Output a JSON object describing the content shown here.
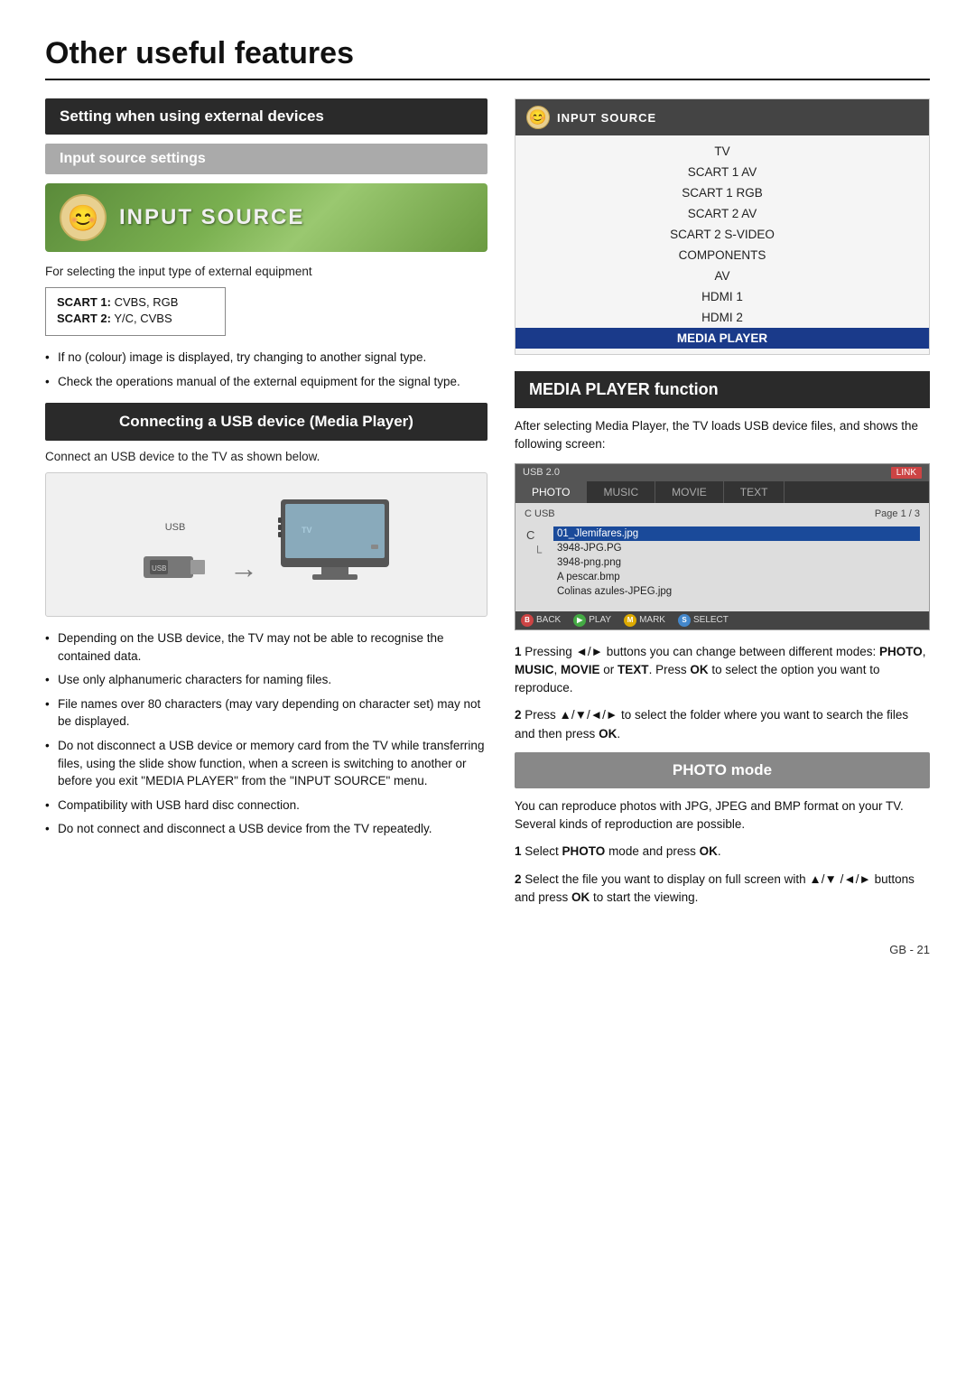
{
  "page": {
    "title": "Other useful features",
    "page_number": "GB - 21"
  },
  "left": {
    "section1": {
      "header": "Setting when using external devices",
      "subsection": "Input source settings",
      "banner_label": "INPUT SOURCE",
      "description": "For selecting the input type of external equipment",
      "scart_info": [
        "SCART 1: CVBS, RGB",
        "SCART 2: Y/C, CVBS"
      ],
      "bullets": [
        "If no (colour) image is displayed, try changing to another signal type.",
        "Check the operations manual of the external equipment for the signal type."
      ]
    },
    "section2": {
      "header": "Connecting a USB device (Media Player)",
      "description": "Connect an USB device to the TV as shown below.",
      "bullets": [
        "Depending on the USB device, the TV may not be able to recognise the contained data.",
        "Use only alphanumeric characters for naming files.",
        "File names over 80 characters (may vary depending on character set) may not be displayed.",
        "Do not disconnect a USB device or memory card from the TV while transferring files, using the slide show function, when a screen is switching to another or before you exit \"MEDIA PLAYER\" from the \"INPUT SOURCE\" menu.",
        "Compatibility with USB hard disc connection.",
        "Do not connect and disconnect a USB device from the TV repeatedly."
      ]
    }
  },
  "right": {
    "input_source_menu": {
      "header": "INPUT SOURCE",
      "items": [
        {
          "label": "TV",
          "active": false
        },
        {
          "label": "SCART 1 AV",
          "active": false
        },
        {
          "label": "SCART 1 RGB",
          "active": false
        },
        {
          "label": "SCART 2 AV",
          "active": false
        },
        {
          "label": "SCART 2 S-VIDEO",
          "active": false
        },
        {
          "label": "COMPONENTS",
          "active": false
        },
        {
          "label": "AV",
          "active": false
        },
        {
          "label": "HDMI 1",
          "active": false
        },
        {
          "label": "HDMI 2",
          "active": false
        },
        {
          "label": "MEDIA PLAYER",
          "active": true
        }
      ]
    },
    "media_player": {
      "header": "MEDIA PLAYER function",
      "description1": "After selecting Media Player, the TV loads USB device files, and shows the following screen:",
      "screen": {
        "topbar_left": "USB 2.0",
        "topbar_right": "LINK",
        "tabs": [
          "PHOTO",
          "MUSIC",
          "MOVIE",
          "TEXT"
        ],
        "active_tab": "PHOTO",
        "path": "C USB",
        "page_info": "Page  1 / 3",
        "files": [
          "C",
          "01_Jlemifares.jpg",
          "3948-JPG.PG",
          "3948-png.png",
          "A pescar.bmp",
          "Colinas azules-JPEG.jpg"
        ],
        "highlighted_file": "01_Jlemifares.jpg",
        "bottom_buttons": [
          {
            "color": "#cc4444",
            "label": "BACK"
          },
          {
            "color": "#44aa44",
            "label": "PLAY"
          },
          {
            "color": "#ddaa00",
            "label": "MARK"
          },
          {
            "color": "#4488cc",
            "label": "SELECT"
          }
        ]
      },
      "text1": "1 Pressing ◄/► buttons you can change between different modes: PHOTO, MUSIC, MOVIE or TEXT. Press OK to select the option you want to reproduce.",
      "text2": "2 Press ▲/▼/◄/► to select the folder where you want to search the files and then press OK."
    },
    "photo_mode": {
      "header": "PHOTO mode",
      "description": "You can reproduce photos with JPG, JPEG and BMP format on your TV.\nSeveral kinds of reproduction are possible.",
      "steps": [
        "1 Select PHOTO mode and press OK.",
        "2 Select the file you want to display on full screen with ▲/▼ /◄/► buttons and press OK to start the viewing."
      ]
    }
  }
}
